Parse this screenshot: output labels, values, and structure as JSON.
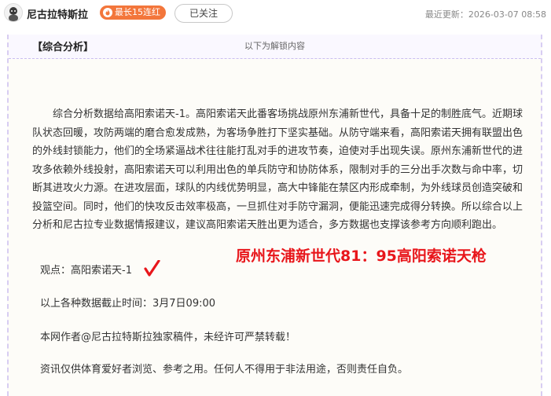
{
  "header": {
    "author": "尼古拉特斯拉",
    "streak_badge": "最长15连红",
    "follow_label": "已关注",
    "updated": "最近更新：2026-03-07 08:58"
  },
  "unlock_bar": "以下为解锁内容",
  "article": {
    "section_title": "【综合分析】",
    "analysis": "综合分析数据给高阳索诺天-1。高阳索诺天此番客场挑战原州东浦新世代，具备十足的制胜底气。近期球队状态回暖，攻防两端的磨合愈发成熟，为客场争胜打下坚实基础。从防守端来看，高阳索诺天拥有联盟出色的外线封锁能力，他们的全场紧逼战术往往能打乱对手的进攻节奏，迫使对手出现失误。原州东浦新世代的进攻多依赖外线投射，高阳索诺天可以利用出色的单兵防守和协防体系，限制对手的三分出手次数与命中率，切断其进攻火力源。在进攻层面，球队的内线优势明显，高大中锋能在禁区内形成牵制，为外线球员创造突破和投篮空间。同时，他们的快攻反击效率极高，一旦抓住对手防守漏洞，便能迅速完成得分转换。所以综合以上分析和尼古拉专业数据情报建议，建议高阳索诺天胜出更为适合，多方数据也支撑该参考方向顺利跑出。",
    "viewpoint": "观点：高阳索诺天-1",
    "score_overlay": "原州东浦新世代81：95高阳索诺天枪",
    "data_cutoff": "以上各种数据截止时间：3月7日09:00",
    "copyright": "本网作者@尼古拉特斯拉独家稿件，未经许可严禁转载！",
    "disclaimer": "资讯仅供体育爱好者浏览、参考之用。任何人不得用于非法用途，否则责任自负。"
  },
  "colors": {
    "streak_bg": "#f3763b",
    "score_red": "#e8161b",
    "unlock_border": "#c9bdf0"
  }
}
